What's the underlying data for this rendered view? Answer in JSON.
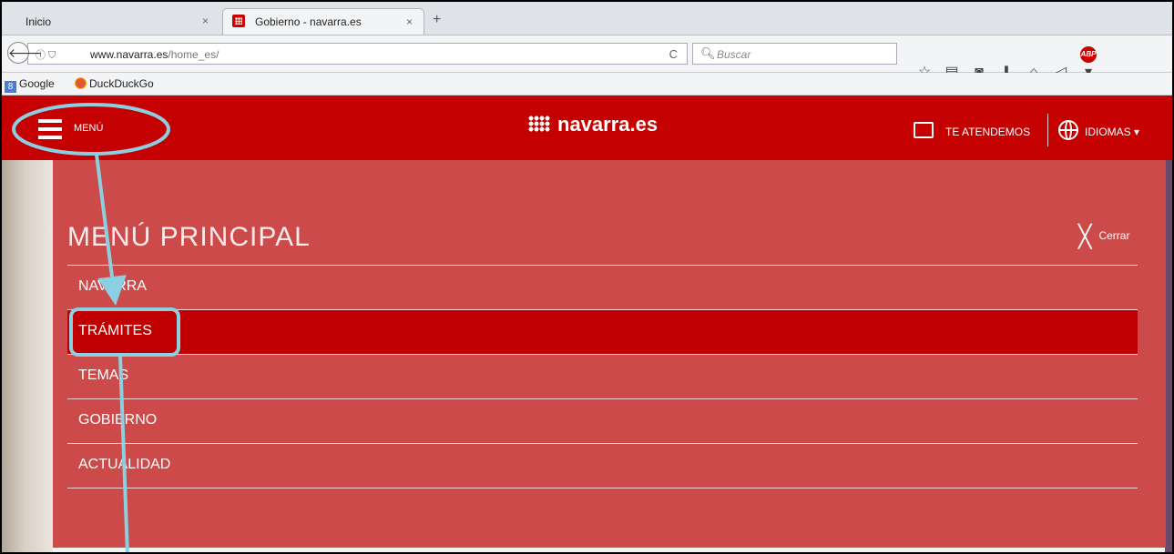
{
  "browser": {
    "tabs": [
      {
        "title": "Inicio",
        "close": "×"
      },
      {
        "title": "Gobierno - navarra.es",
        "close": "×"
      }
    ],
    "new_tab": "+",
    "url_domain": "www.navarra.es",
    "url_path": "/home_es/",
    "url_info": "ⓘ ⛉",
    "reload": "C",
    "search_placeholder": "Buscar",
    "toolbar_icons": [
      "star-icon",
      "reading-list-icon",
      "pocket-icon",
      "download-icon",
      "home-icon",
      "share-icon",
      "adblock-icon"
    ],
    "abp_label": "ABP",
    "bookmarks": [
      {
        "label": "Google",
        "icon": "google-icon"
      },
      {
        "label": "DuckDuckGo",
        "icon": "duckduckgo-icon"
      }
    ]
  },
  "header": {
    "menu_label": "MENÚ",
    "logo_text": "navarra.es",
    "contact_label": "TE ATENDEMOS",
    "language_label": "IDIOMAS ▾"
  },
  "menu": {
    "title": "MENÚ PRINCIPAL",
    "close_label": "Cerrar",
    "items": [
      {
        "label": "NAVARRA",
        "active": false
      },
      {
        "label": "TRÁMITES",
        "active": true
      },
      {
        "label": "TEMAS",
        "active": false
      },
      {
        "label": "GOBIERNO",
        "active": false
      },
      {
        "label": "ACTUALIDAD",
        "active": false
      }
    ]
  },
  "colors": {
    "header_red": "#c40000",
    "panel_red": "#cc4a4a",
    "active_red": "#c00000",
    "annotation_blue": "#8ccfe0"
  }
}
